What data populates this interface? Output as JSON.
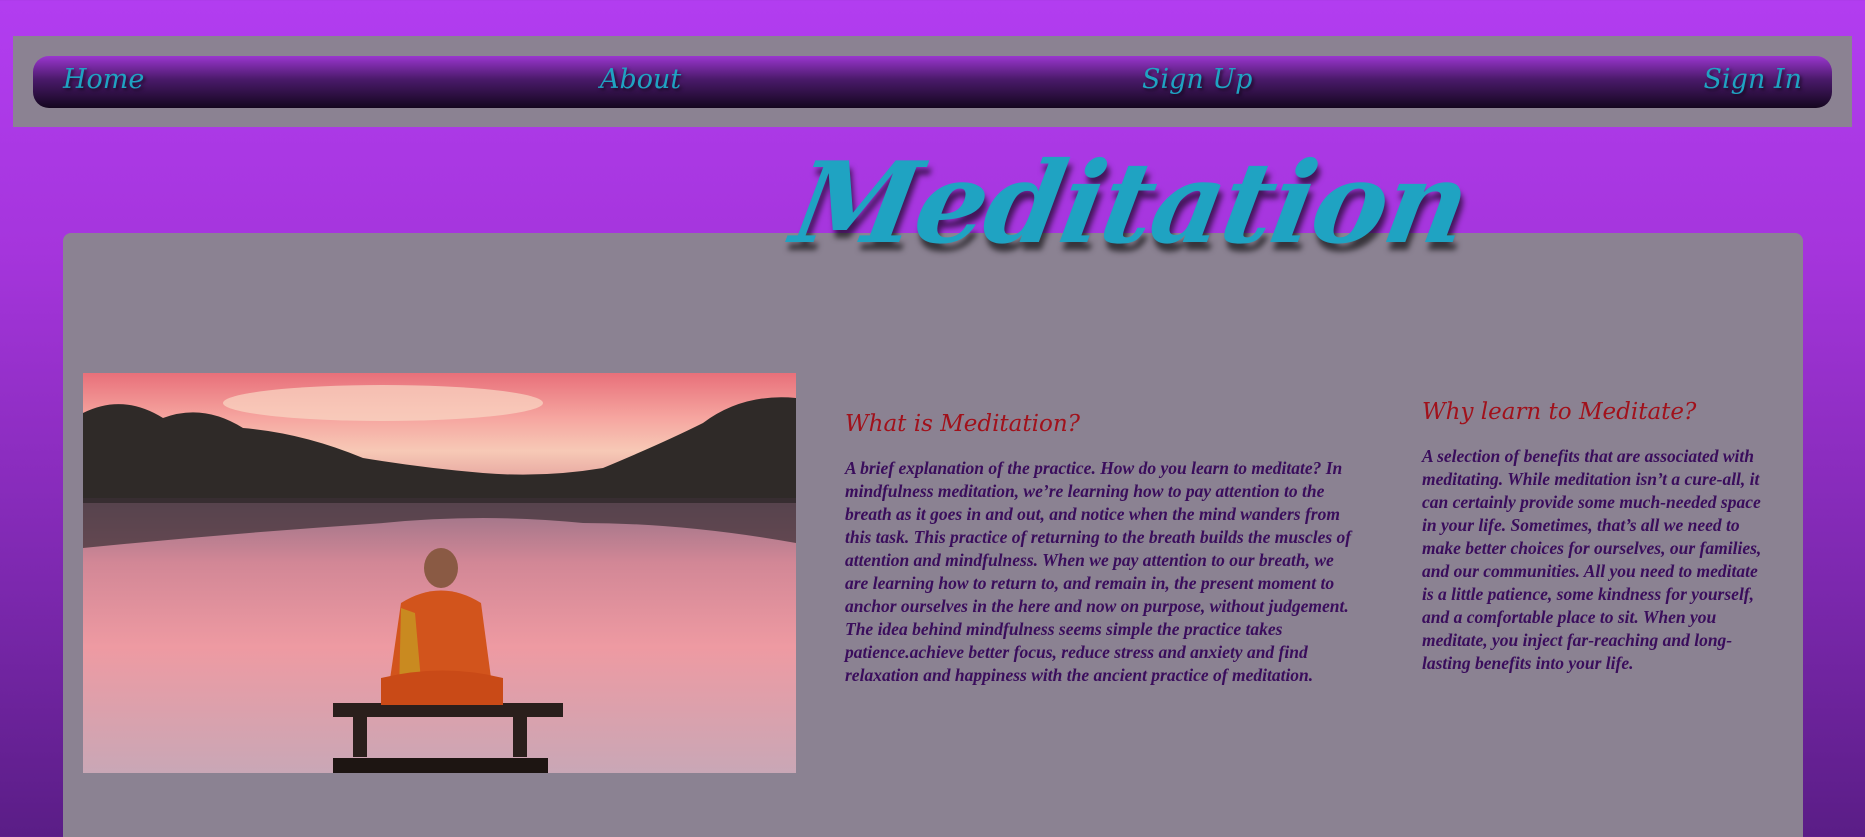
{
  "nav": {
    "home": "Home",
    "about": "About",
    "signup": "Sign Up",
    "signin": "Sign In"
  },
  "hero": {
    "title": "Meditation"
  },
  "sections": {
    "what": {
      "heading": "What is Meditation?",
      "body": "A brief explanation of the practice. How do you learn to meditate? In mindfulness meditation, we’re learning how to pay attention to the breath as it goes in and out, and notice when the mind wanders from this task. This practice of returning to the breath builds the muscles of attention and mindfulness. When we pay attention to our breath, we are learning how to return to, and remain in, the present moment to anchor ourselves in the here and now on purpose, without judgement. The idea behind mindfulness seems simple the practice takes patience.achieve better focus, reduce stress and anxiety and find relaxation and happiness with the ancient practice of meditation."
    },
    "why": {
      "heading": "Why learn to Meditate?",
      "body": "A selection of benefits that are associated with meditating. While meditation isn’t a cure-all, it can certainly provide some much-needed space in your life. Sometimes, that’s all we need to make better choices for ourselves, our families, and our communities. All you need to meditate is a little patience, some kindness for yourself, and a comfortable place to sit. When you meditate, you inject far-reaching and long-lasting benefits into your life."
    }
  },
  "colors": {
    "accent": "#1fa3c2",
    "heading": "#a1111b",
    "panel": "#8b8292",
    "background": "#a535dc"
  }
}
